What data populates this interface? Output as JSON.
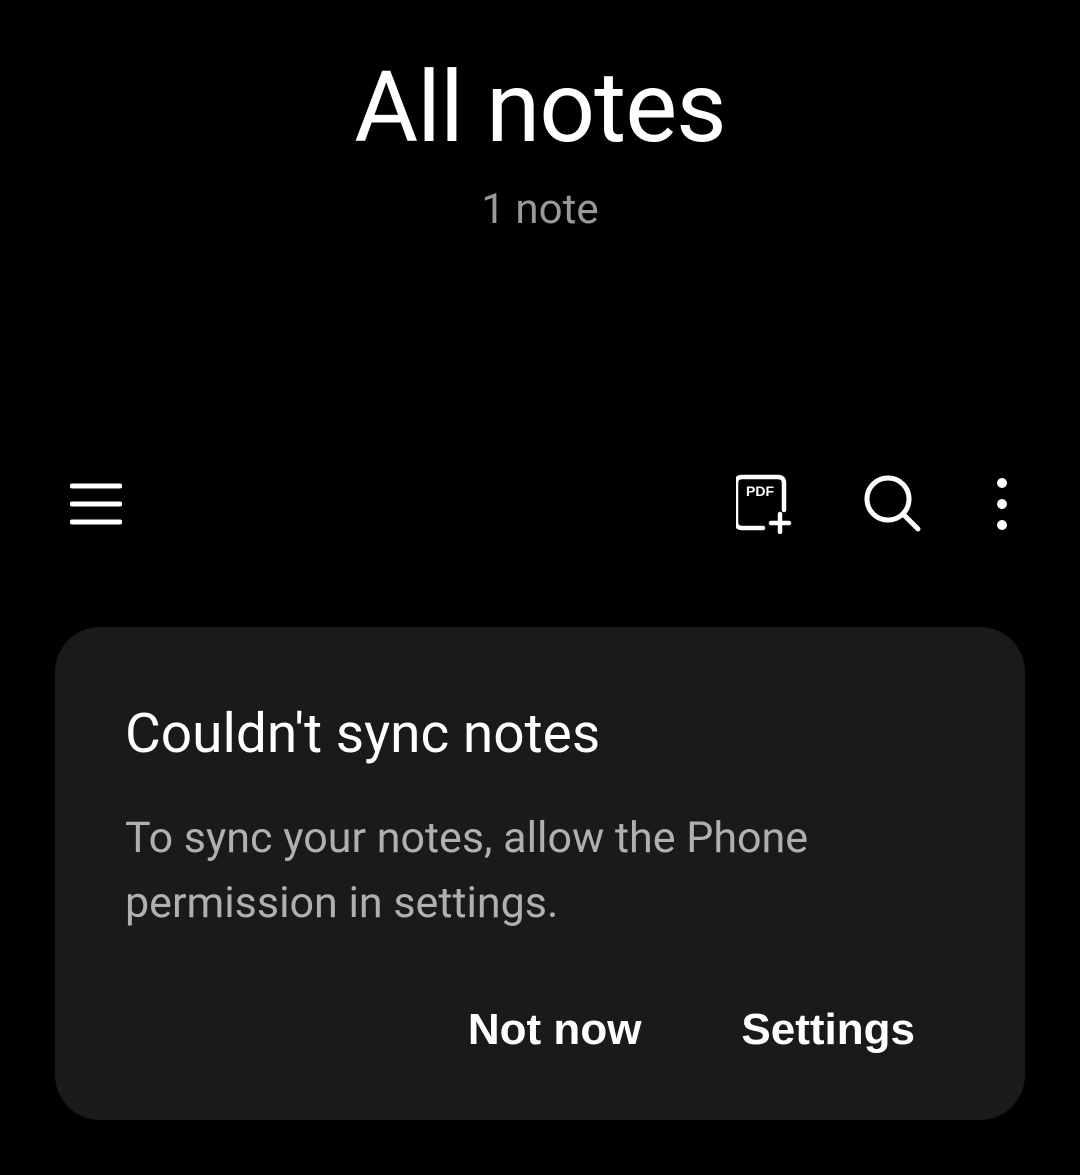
{
  "header": {
    "title": "All notes",
    "subtitle": "1 note"
  },
  "toolbar": {
    "menu_icon": "menu",
    "pdf_icon": "pdf-import",
    "search_icon": "search",
    "more_icon": "more-vertical"
  },
  "sync_card": {
    "title": "Couldn't sync notes",
    "message": "To sync your notes, allow the Phone permission in settings.",
    "not_now_label": "Not now",
    "settings_label": "Settings"
  }
}
